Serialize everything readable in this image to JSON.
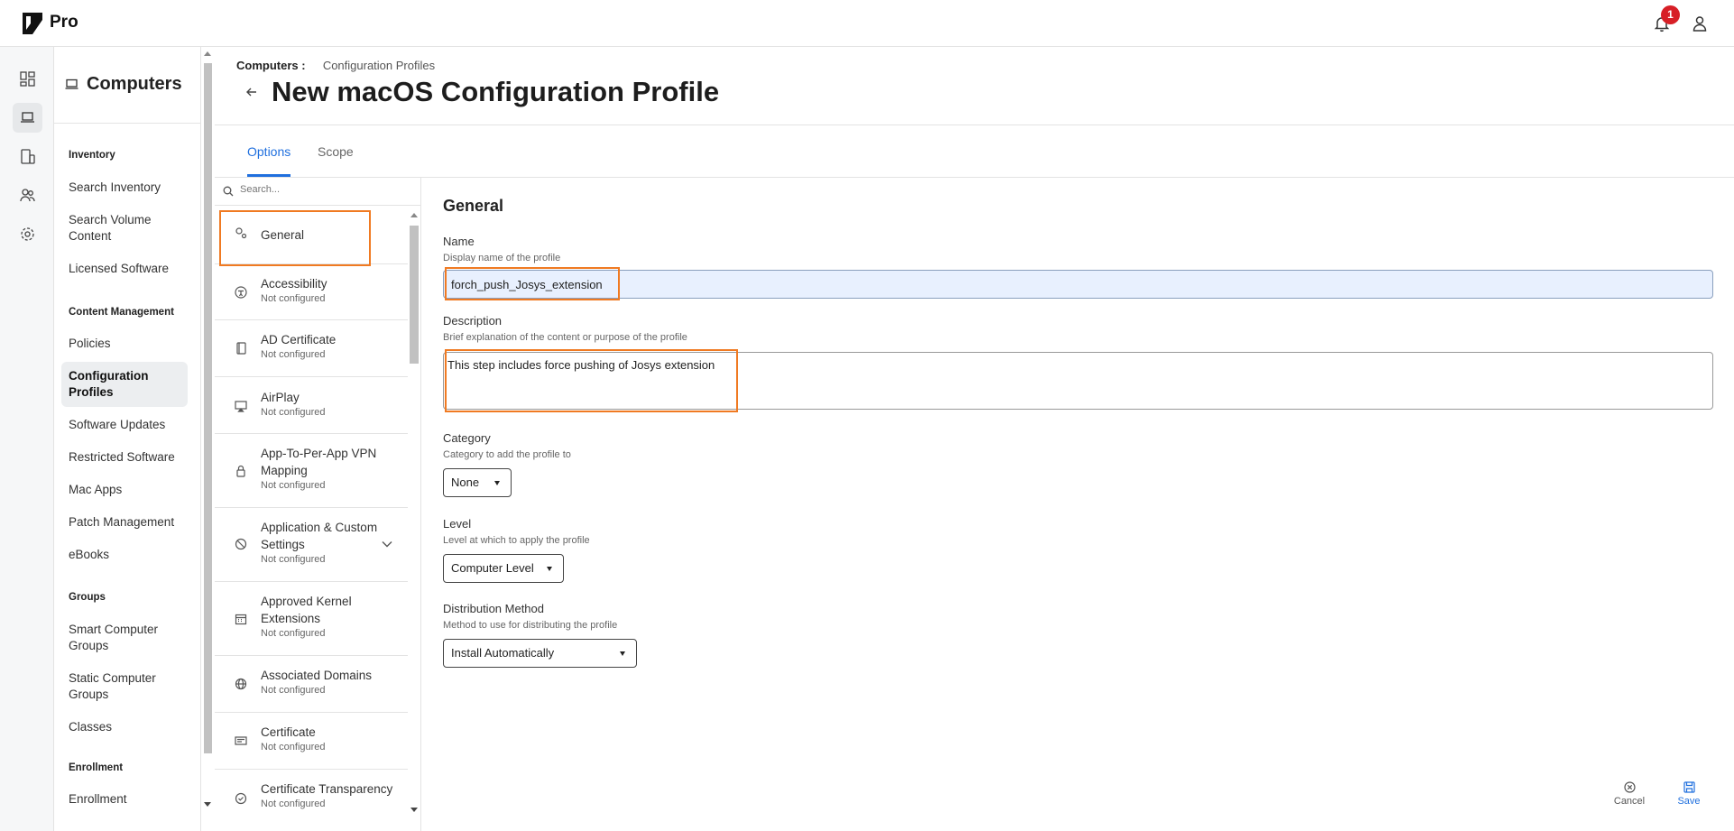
{
  "app": {
    "brand": "Pro",
    "notification_count": "1"
  },
  "sidebar": {
    "title": "Computers",
    "sections": [
      {
        "label": "Inventory",
        "items": [
          "Search Inventory",
          "Search Volume Content",
          "Licensed Software"
        ]
      },
      {
        "label": "Content Management",
        "items": [
          "Policies",
          "Configuration Profiles",
          "Software Updates",
          "Restricted Software",
          "Mac Apps",
          "Patch Management",
          "eBooks"
        ]
      },
      {
        "label": "Groups",
        "items": [
          "Smart Computer Groups",
          "Static Computer Groups",
          "Classes"
        ]
      },
      {
        "label": "Enrollment",
        "items": [
          "Enrollment"
        ]
      }
    ],
    "active_item": "Configuration Profiles"
  },
  "header": {
    "breadcrumb_root": "Computers :",
    "breadcrumb_current": "Configuration Profiles",
    "title": "New macOS Configuration Profile"
  },
  "tabs": [
    {
      "label": "Options",
      "active": true
    },
    {
      "label": "Scope",
      "active": false
    }
  ],
  "payloads": {
    "search_placeholder": "Search...",
    "items": [
      {
        "name": "General",
        "status": "",
        "icon": "gear-icon"
      },
      {
        "name": "Accessibility",
        "status": "Not configured",
        "icon": "accessibility-icon"
      },
      {
        "name": "AD Certificate",
        "status": "Not configured",
        "icon": "certificate-book-icon"
      },
      {
        "name": "AirPlay",
        "status": "Not configured",
        "icon": "airplay-icon"
      },
      {
        "name": "App-To-Per-App VPN Mapping",
        "status": "Not configured",
        "icon": "lock-icon"
      },
      {
        "name": "Application & Custom Settings",
        "status": "Not configured",
        "icon": "no-entry-icon"
      },
      {
        "name": "Approved Kernel Extensions",
        "status": "Not configured",
        "icon": "calendar-icon"
      },
      {
        "name": "Associated Domains",
        "status": "Not configured",
        "icon": "globe-icon"
      },
      {
        "name": "Certificate",
        "status": "Not configured",
        "icon": "certificate-icon"
      },
      {
        "name": "Certificate Transparency",
        "status": "Not configured",
        "icon": "check-circle-icon"
      }
    ]
  },
  "form": {
    "section_title": "General",
    "name": {
      "label": "Name",
      "hint": "Display name of the profile",
      "value": "forch_push_Josys_extension"
    },
    "description": {
      "label": "Description",
      "hint": "Brief explanation of the content or purpose of the profile",
      "value": "This step includes force pushing of Josys extension"
    },
    "category": {
      "label": "Category",
      "hint": "Category to add the profile to",
      "value": "None"
    },
    "level": {
      "label": "Level",
      "hint": "Level at which to apply the profile",
      "value": "Computer Level"
    },
    "distribution": {
      "label": "Distribution Method",
      "hint": "Method to use for distributing the profile",
      "value": "Install Automatically"
    }
  },
  "footer": {
    "cancel_label": "Cancel",
    "save_label": "Save"
  },
  "colors": {
    "accent": "#1f6fde",
    "highlight": "#f07a22",
    "badge": "#d71f26"
  }
}
